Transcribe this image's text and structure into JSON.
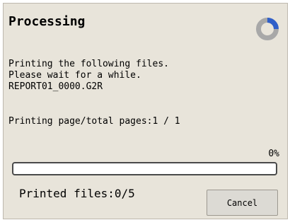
{
  "dialog": {
    "title": "Processing",
    "spinner_icon": "loading-spinner-icon",
    "message_lines": [
      "Printing the following files.",
      "Please wait for a while.",
      "REPORT01_0000.G2R"
    ],
    "page_status": "Printing page/total pages:1 / 1",
    "progress": {
      "percent_label": "0%",
      "value": 0
    },
    "printed_files": "Printed files:0/5",
    "cancel_label": "Cancel"
  },
  "colors": {
    "dialog_background": "#e8e4da",
    "progress_fill": "#3b6bd6",
    "spinner_track": "#a8a8a8",
    "spinner_arc": "#2f5fc9"
  }
}
